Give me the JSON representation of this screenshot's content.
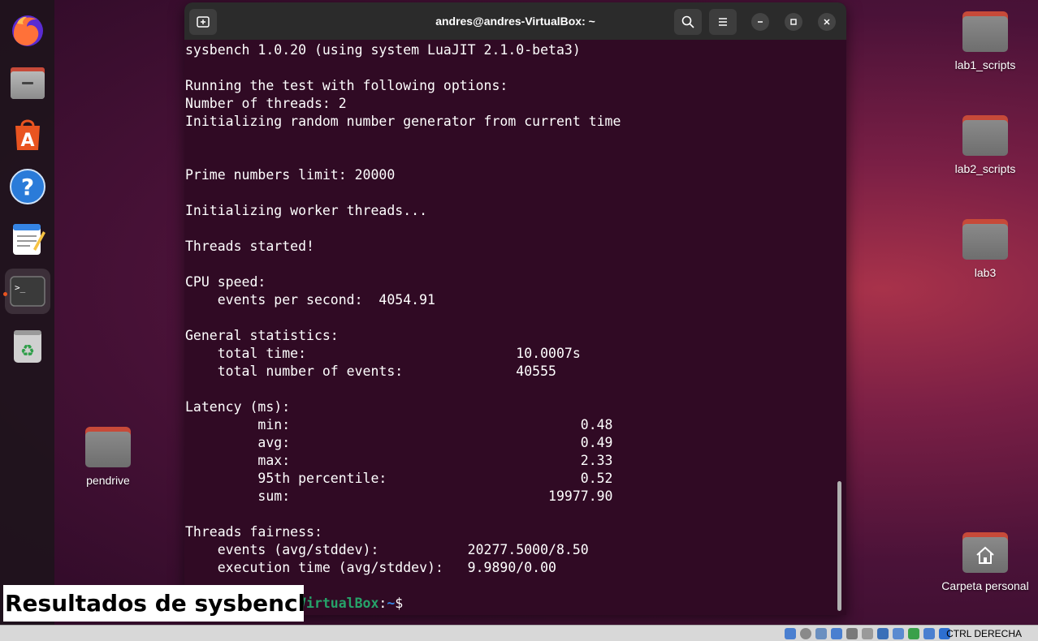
{
  "window": {
    "title": "andres@andres-VirtualBox: ~"
  },
  "dock": {
    "apps": [
      "firefox-icon",
      "files-icon",
      "app-center-icon",
      "help-icon",
      "text-editor-icon",
      "terminal-icon",
      "trash-icon"
    ]
  },
  "desktop": {
    "icons": [
      {
        "label": "lab1_scripts"
      },
      {
        "label": "lab2_scripts"
      },
      {
        "label": "lab3"
      },
      {
        "label": "pendrive"
      },
      {
        "label": "Carpeta personal"
      }
    ]
  },
  "terminal": {
    "lines": [
      "sysbench 1.0.20 (using system LuaJIT 2.1.0-beta3)",
      "",
      "Running the test with following options:",
      "Number of threads: 2",
      "Initializing random number generator from current time",
      "",
      "",
      "Prime numbers limit: 20000",
      "",
      "Initializing worker threads...",
      "",
      "Threads started!",
      "",
      "CPU speed:",
      "    events per second:  4054.91",
      "",
      "General statistics:",
      "    total time:                          10.0007s",
      "    total number of events:              40555",
      "",
      "Latency (ms):",
      "         min:                                    0.48",
      "         avg:                                    0.49",
      "         max:                                    2.33",
      "         95th percentile:                        0.52",
      "         sum:                                19977.90",
      "",
      "Threads fairness:",
      "    events (avg/stddev):           20277.5000/8.50",
      "    execution time (avg/stddev):   9.9890/0.00",
      ""
    ],
    "prompt_user": "andres@andres-VirtualBox",
    "prompt_sep": ":",
    "prompt_path": "~",
    "prompt_symbol": "$"
  },
  "caption": {
    "text": "Resultados de sysbench"
  },
  "statusbar": {
    "host_key": "CTRL DERECHA"
  },
  "colors": {
    "terminal_bg": "#300a24",
    "prompt_user": "#26a269",
    "prompt_path": "#3584e4",
    "folder_tab": "#c74a39"
  }
}
